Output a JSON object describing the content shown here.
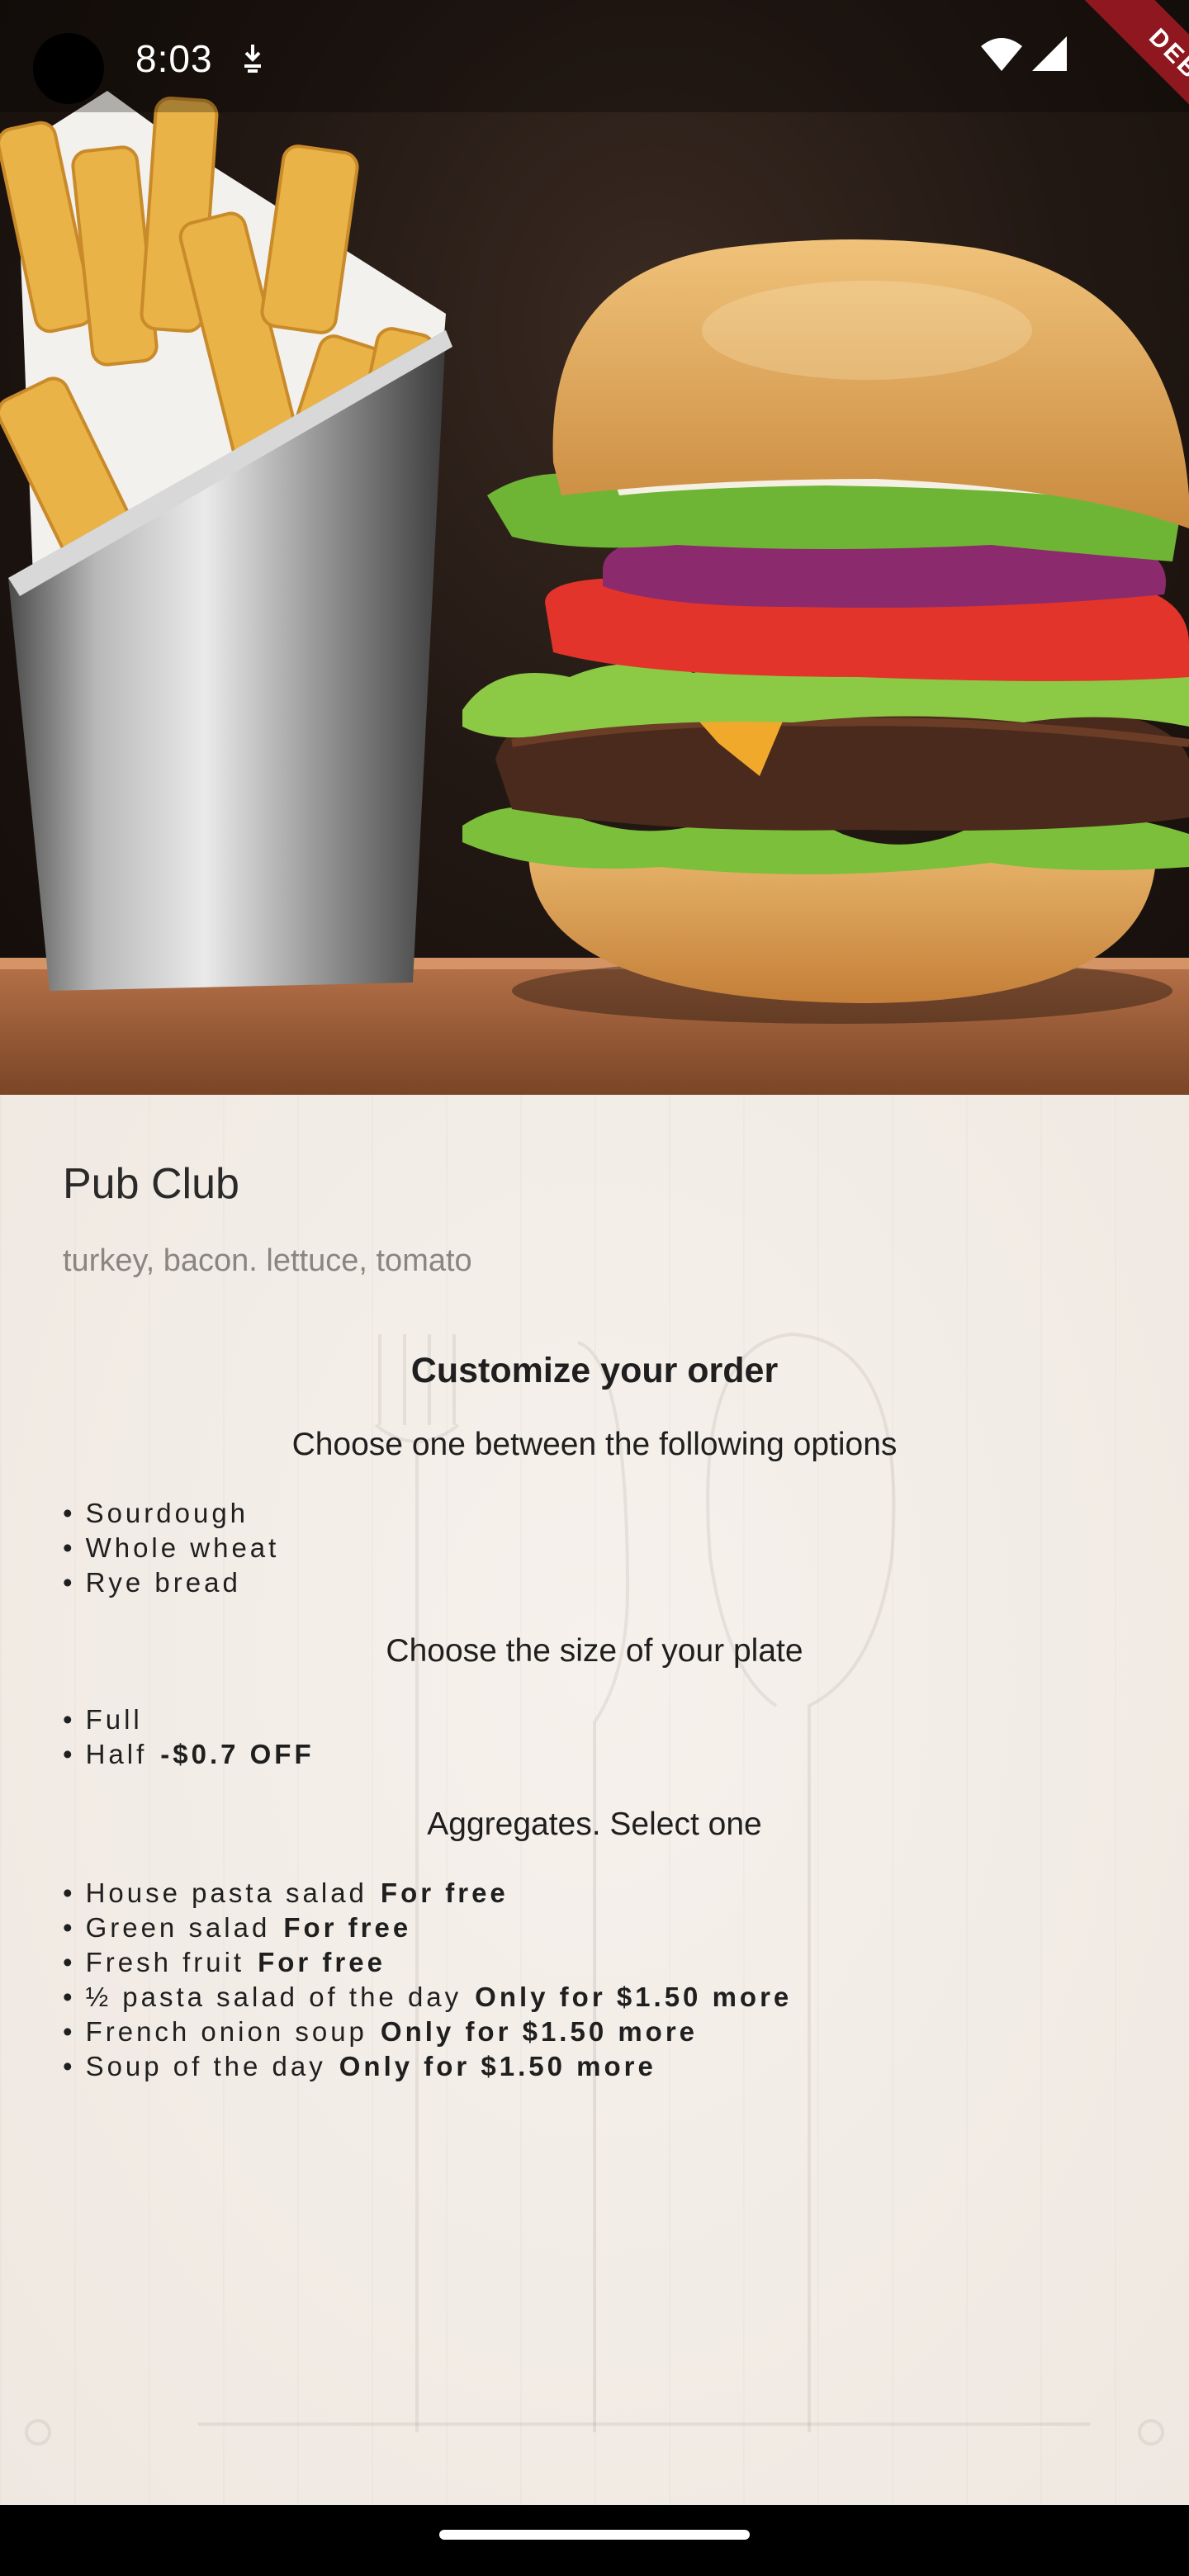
{
  "status_bar": {
    "time": "8:03",
    "debug_label": "DEBUG",
    "icons": [
      "download-status-icon",
      "wifi-icon",
      "signal-icon"
    ]
  },
  "hero": {
    "image": "burger-and-fries-photo"
  },
  "item": {
    "name": "Pub Club",
    "description": "turkey, bacon. lettuce, tomato"
  },
  "customize": {
    "heading": "Customize your order",
    "bread": {
      "prompt": "Choose one between the following options",
      "options": [
        {
          "label": "Sourdough",
          "extra": ""
        },
        {
          "label": "Whole wheat",
          "extra": ""
        },
        {
          "label": "Rye bread",
          "extra": ""
        }
      ]
    },
    "size": {
      "prompt": "Choose the size of your plate",
      "options": [
        {
          "label": "Full",
          "extra": ""
        },
        {
          "label": "Half",
          "extra": "-$0.7 OFF"
        }
      ]
    },
    "aggregates": {
      "prompt": "Aggregates. Select one",
      "options": [
        {
          "label": "House pasta salad",
          "extra": "For free"
        },
        {
          "label": "Green salad",
          "extra": "For free"
        },
        {
          "label": "Fresh fruit",
          "extra": "For free"
        },
        {
          "label": "½ pasta salad of the day",
          "extra": "Only for $1.50 more"
        },
        {
          "label": "French onion soup",
          "extra": "Only for $1.50 more"
        },
        {
          "label": "Soup of the day",
          "extra": "Only for $1.50 more"
        }
      ]
    },
    "bullet": "•"
  },
  "colors": {
    "panel_bg": "#f2ece6",
    "text_primary": "#1f1f1f",
    "text_secondary": "#8a8580",
    "debug_banner": "#a51923"
  }
}
